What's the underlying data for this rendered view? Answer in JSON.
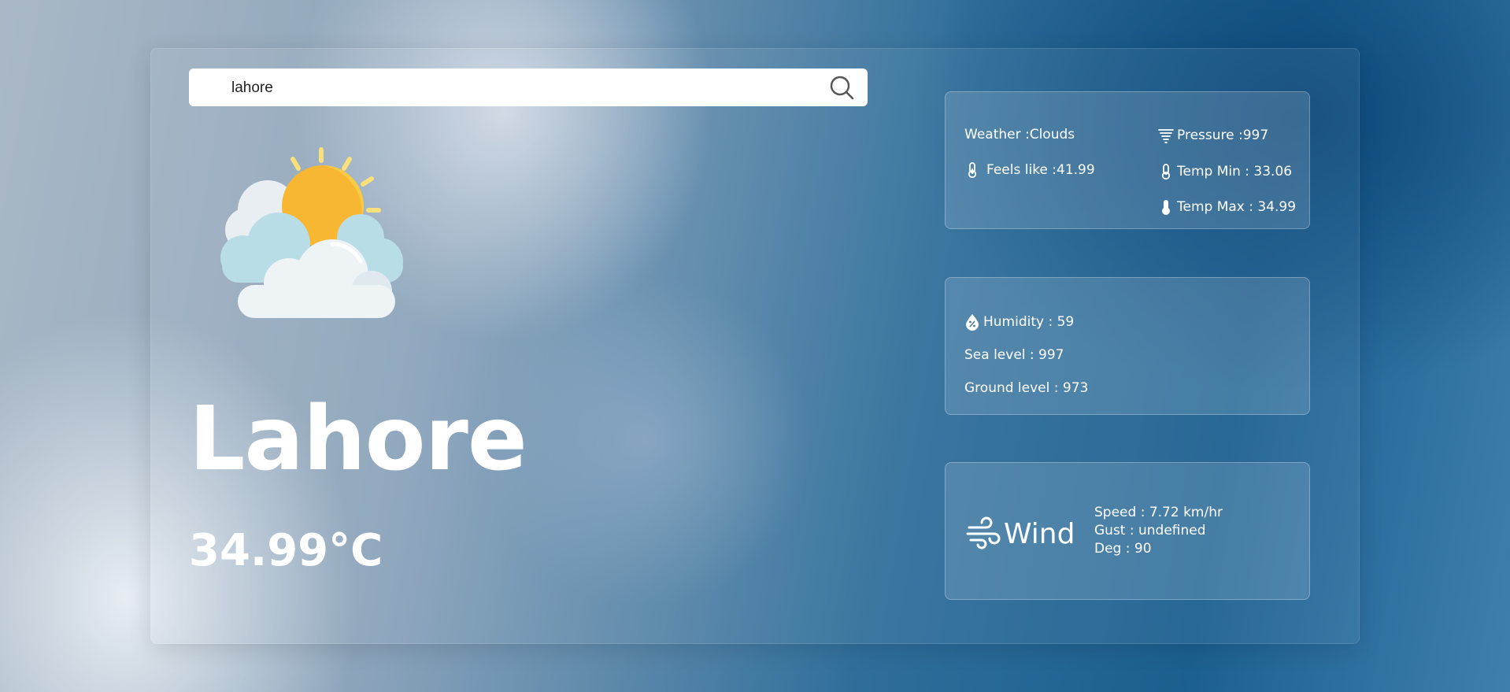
{
  "search": {
    "value": "lahore",
    "icon": "search-icon"
  },
  "main": {
    "weather_icon": "partly-cloudy-sun-icon",
    "city": "Lahore",
    "temperature": "34.99°C"
  },
  "cards": {
    "conditions": {
      "weather": "Weather :Clouds",
      "feels_like": "Feels like :41.99",
      "pressure": "Pressure :997",
      "temp_min": "Temp Min : 33.06",
      "temp_max": "Temp Max : 34.99"
    },
    "levels": {
      "humidity": "Humidity : 59",
      "sea_level": "Sea level : 997",
      "ground_level": "Ground level : 973"
    },
    "wind": {
      "title": "Wind",
      "speed": "Speed : 7.72 km/hr",
      "gust": "Gust : undefined",
      "deg": "Deg : 90"
    }
  },
  "colors": {
    "text": "#ffffff",
    "sun": "#f7b733",
    "cloud_light": "#eef3f6",
    "cloud_blue": "#b9dde6"
  }
}
